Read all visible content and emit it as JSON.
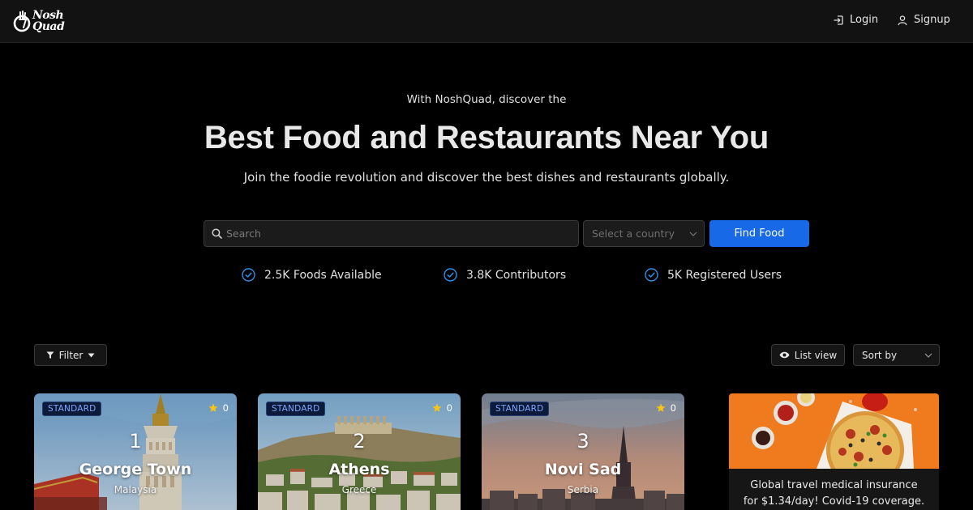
{
  "header": {
    "logo_line1": "Nosh",
    "logo_line2": "Quad",
    "login_label": "Login",
    "signup_label": "Signup"
  },
  "hero": {
    "subtitle": "With NoshQuad, discover the",
    "title": "Best Food and Restaurants Near You",
    "description": "Join the foodie revolution and discover the best dishes and restaurants globally."
  },
  "search": {
    "placeholder": "Search",
    "country_placeholder": "Select a country",
    "button_label": "Find Food"
  },
  "stats": [
    {
      "label": "2.5K Foods Available"
    },
    {
      "label": "3.8K Contributors"
    },
    {
      "label": "5K Registered Users"
    }
  ],
  "toolbar": {
    "filter_label": "Filter",
    "list_view_label": "List view",
    "sort_label": "Sort by"
  },
  "cards": [
    {
      "badge": "STANDARD",
      "rating": "0",
      "rank": "1",
      "city": "George Town",
      "country": "Malaysia"
    },
    {
      "badge": "STANDARD",
      "rating": "0",
      "rank": "2",
      "city": "Athens",
      "country": "Greece"
    },
    {
      "badge": "STANDARD",
      "rating": "0",
      "rank": "3",
      "city": "Novi Sad",
      "country": "Serbia"
    }
  ],
  "ad": {
    "line1": "Global travel medical insurance",
    "line2": "for $1.34/day! Covid-19 coverage."
  },
  "colors": {
    "accent": "#1769e8",
    "check": "#2f8fe8",
    "star": "#f5c518",
    "badge_text": "#7ea6ff"
  }
}
